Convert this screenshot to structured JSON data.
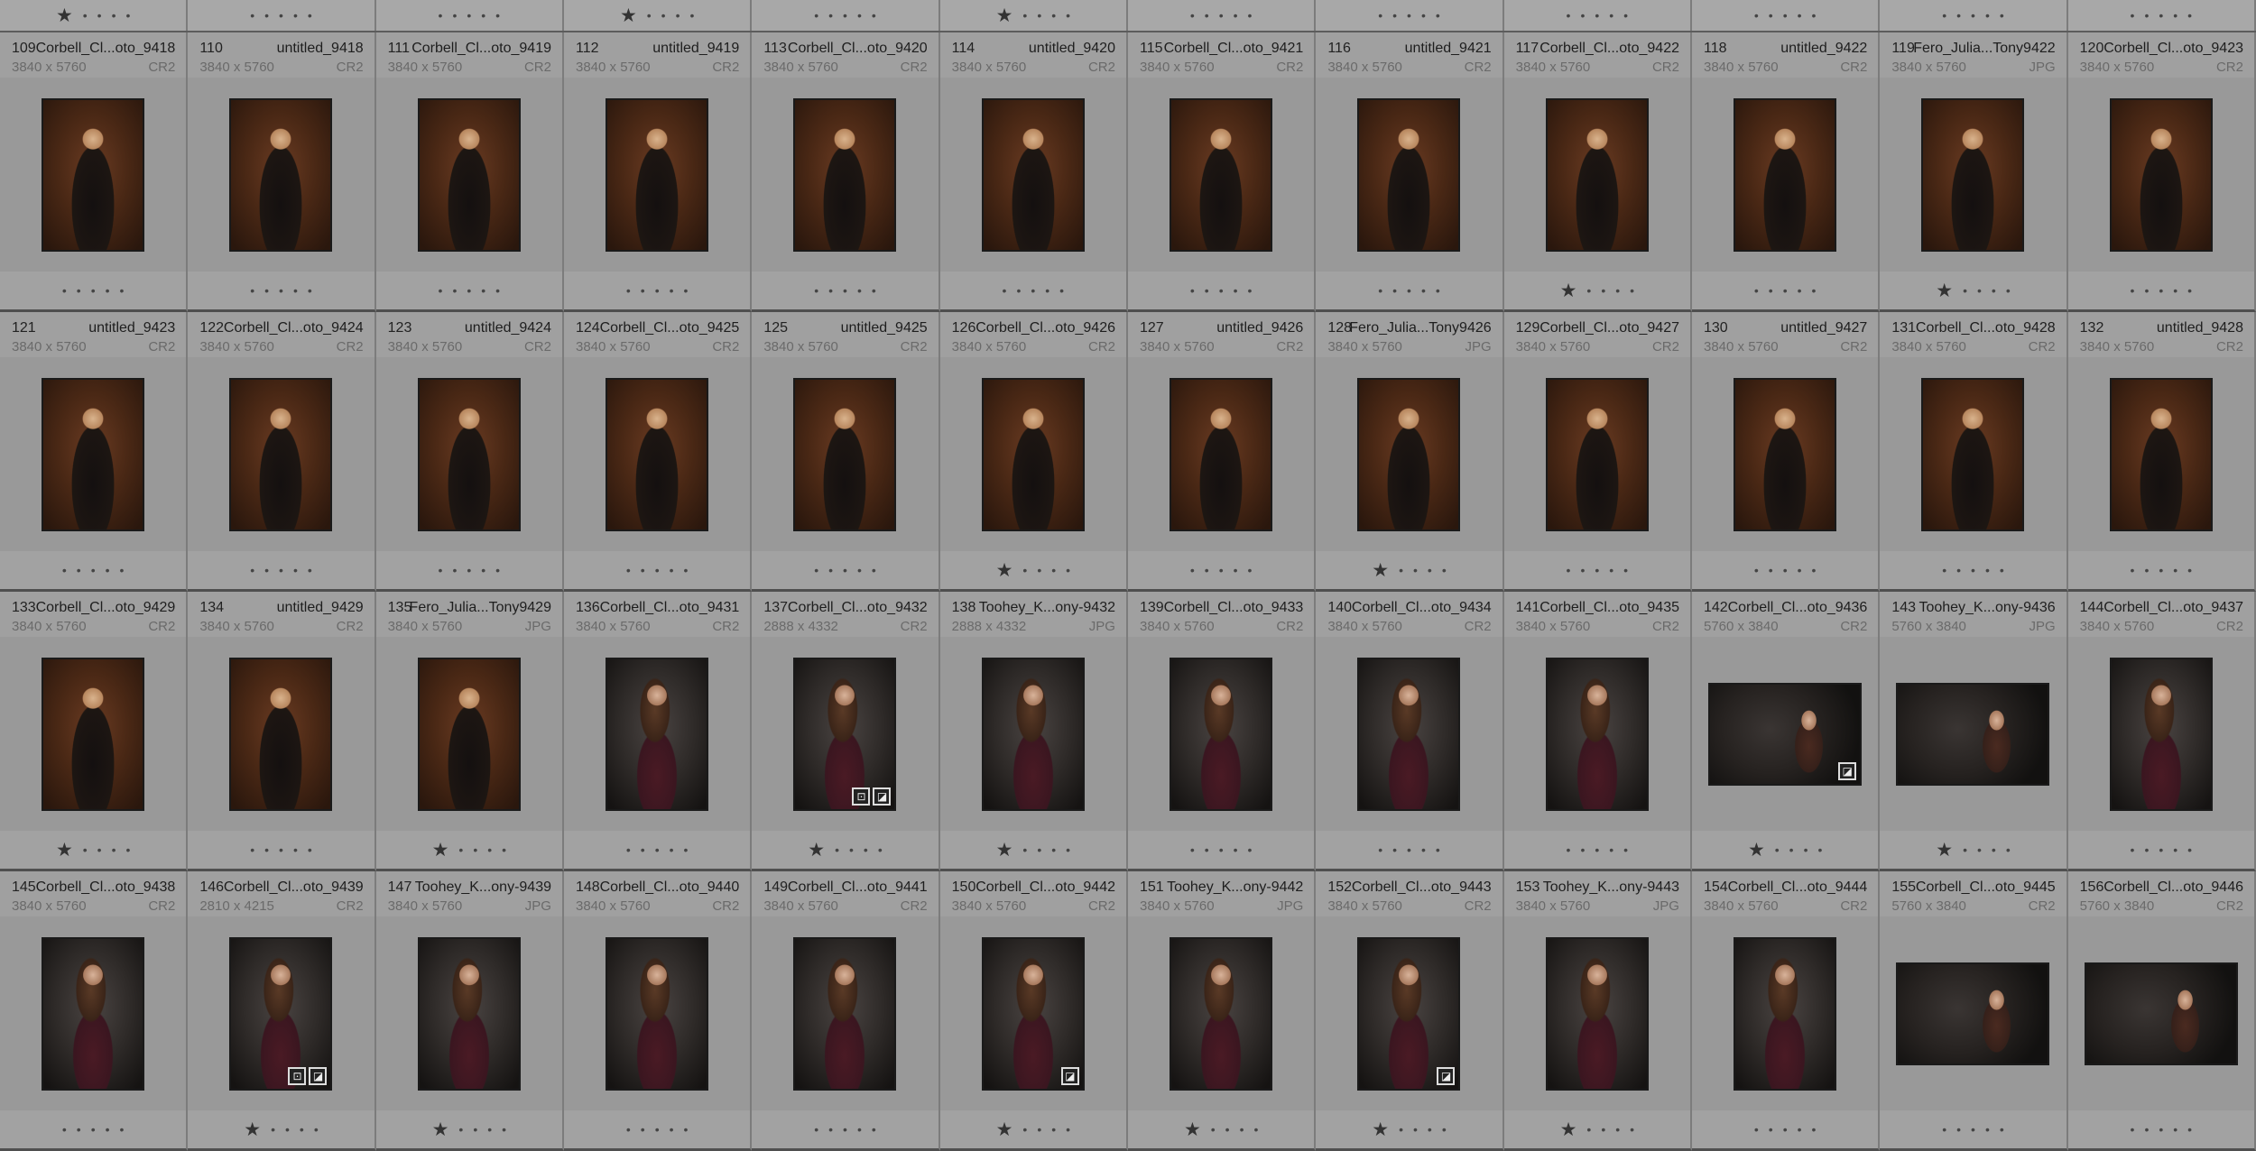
{
  "top_strip_ratings": [
    1,
    0,
    0,
    1,
    0,
    1,
    0,
    0,
    0,
    0,
    0,
    0
  ],
  "rows": [
    [
      {
        "idx": "109",
        "name": "Corbell_Cl...oto_9418",
        "dims": "3840 x 5760",
        "ext": "CR2",
        "rating": 0,
        "style": "warm",
        "orient": "portrait"
      },
      {
        "idx": "110",
        "name": "untitled_9418",
        "dims": "3840 x 5760",
        "ext": "CR2",
        "rating": 0,
        "style": "warm",
        "orient": "portrait"
      },
      {
        "idx": "111",
        "name": "Corbell_Cl...oto_9419",
        "dims": "3840 x 5760",
        "ext": "CR2",
        "rating": 0,
        "style": "warm",
        "orient": "portrait"
      },
      {
        "idx": "112",
        "name": "untitled_9419",
        "dims": "3840 x 5760",
        "ext": "CR2",
        "rating": 0,
        "style": "warm",
        "orient": "portrait"
      },
      {
        "idx": "113",
        "name": "Corbell_Cl...oto_9420",
        "dims": "3840 x 5760",
        "ext": "CR2",
        "rating": 0,
        "style": "warm",
        "orient": "portrait"
      },
      {
        "idx": "114",
        "name": "untitled_9420",
        "dims": "3840 x 5760",
        "ext": "CR2",
        "rating": 0,
        "style": "warm",
        "orient": "portrait"
      },
      {
        "idx": "115",
        "name": "Corbell_Cl...oto_9421",
        "dims": "3840 x 5760",
        "ext": "CR2",
        "rating": 0,
        "style": "warm",
        "orient": "portrait"
      },
      {
        "idx": "116",
        "name": "untitled_9421",
        "dims": "3840 x 5760",
        "ext": "CR2",
        "rating": 0,
        "style": "warm",
        "orient": "portrait"
      },
      {
        "idx": "117",
        "name": "Corbell_Cl...oto_9422",
        "dims": "3840 x 5760",
        "ext": "CR2",
        "rating": 1,
        "style": "warm",
        "orient": "portrait"
      },
      {
        "idx": "118",
        "name": "untitled_9422",
        "dims": "3840 x 5760",
        "ext": "CR2",
        "rating": 0,
        "style": "warm",
        "orient": "portrait"
      },
      {
        "idx": "119",
        "name": "Fero_Julia...Tony9422",
        "dims": "3840 x 5760",
        "ext": "JPG",
        "rating": 1,
        "style": "warm",
        "orient": "portrait"
      },
      {
        "idx": "120",
        "name": "Corbell_Cl...oto_9423",
        "dims": "3840 x 5760",
        "ext": "CR2",
        "rating": 0,
        "style": "warm",
        "orient": "portrait"
      }
    ],
    [
      {
        "idx": "121",
        "name": "untitled_9423",
        "dims": "3840 x 5760",
        "ext": "CR2",
        "rating": 0,
        "style": "warm",
        "orient": "portrait"
      },
      {
        "idx": "122",
        "name": "Corbell_Cl...oto_9424",
        "dims": "3840 x 5760",
        "ext": "CR2",
        "rating": 0,
        "style": "warm",
        "orient": "portrait"
      },
      {
        "idx": "123",
        "name": "untitled_9424",
        "dims": "3840 x 5760",
        "ext": "CR2",
        "rating": 0,
        "style": "warm",
        "orient": "portrait"
      },
      {
        "idx": "124",
        "name": "Corbell_Cl...oto_9425",
        "dims": "3840 x 5760",
        "ext": "CR2",
        "rating": 0,
        "style": "warm",
        "orient": "portrait"
      },
      {
        "idx": "125",
        "name": "untitled_9425",
        "dims": "3840 x 5760",
        "ext": "CR2",
        "rating": 0,
        "style": "warm",
        "orient": "portrait"
      },
      {
        "idx": "126",
        "name": "Corbell_Cl...oto_9426",
        "dims": "3840 x 5760",
        "ext": "CR2",
        "rating": 1,
        "style": "warm",
        "orient": "portrait"
      },
      {
        "idx": "127",
        "name": "untitled_9426",
        "dims": "3840 x 5760",
        "ext": "CR2",
        "rating": 0,
        "style": "warm",
        "orient": "portrait"
      },
      {
        "idx": "128",
        "name": "Fero_Julia...Tony9426",
        "dims": "3840 x 5760",
        "ext": "JPG",
        "rating": 1,
        "style": "warm",
        "orient": "portrait"
      },
      {
        "idx": "129",
        "name": "Corbell_Cl...oto_9427",
        "dims": "3840 x 5760",
        "ext": "CR2",
        "rating": 0,
        "style": "warm",
        "orient": "portrait"
      },
      {
        "idx": "130",
        "name": "untitled_9427",
        "dims": "3840 x 5760",
        "ext": "CR2",
        "rating": 0,
        "style": "warm",
        "orient": "portrait"
      },
      {
        "idx": "131",
        "name": "Corbell_Cl...oto_9428",
        "dims": "3840 x 5760",
        "ext": "CR2",
        "rating": 0,
        "style": "warm",
        "orient": "portrait"
      },
      {
        "idx": "132",
        "name": "untitled_9428",
        "dims": "3840 x 5760",
        "ext": "CR2",
        "rating": 0,
        "style": "warm",
        "orient": "portrait"
      }
    ],
    [
      {
        "idx": "133",
        "name": "Corbell_Cl...oto_9429",
        "dims": "3840 x 5760",
        "ext": "CR2",
        "rating": 1,
        "style": "warm",
        "orient": "portrait"
      },
      {
        "idx": "134",
        "name": "untitled_9429",
        "dims": "3840 x 5760",
        "ext": "CR2",
        "rating": 0,
        "style": "warm",
        "orient": "portrait"
      },
      {
        "idx": "135",
        "name": "Fero_Julia...Tony9429",
        "dims": "3840 x 5760",
        "ext": "JPG",
        "rating": 1,
        "style": "warm",
        "orient": "portrait"
      },
      {
        "idx": "136",
        "name": "Corbell_Cl...oto_9431",
        "dims": "3840 x 5760",
        "ext": "CR2",
        "rating": 0,
        "style": "dark",
        "orient": "portrait"
      },
      {
        "idx": "137",
        "name": "Corbell_Cl...oto_9432",
        "dims": "2888 x 4332",
        "ext": "CR2",
        "rating": 1,
        "style": "dark",
        "orient": "portrait",
        "badges": [
          "crop",
          "edit"
        ]
      },
      {
        "idx": "138",
        "name": "Toohey_K...ony-9432",
        "dims": "2888 x 4332",
        "ext": "JPG",
        "rating": 1,
        "style": "dark",
        "orient": "portrait"
      },
      {
        "idx": "139",
        "name": "Corbell_Cl...oto_9433",
        "dims": "3840 x 5760",
        "ext": "CR2",
        "rating": 0,
        "style": "dark",
        "orient": "portrait"
      },
      {
        "idx": "140",
        "name": "Corbell_Cl...oto_9434",
        "dims": "3840 x 5760",
        "ext": "CR2",
        "rating": 0,
        "style": "dark",
        "orient": "portrait"
      },
      {
        "idx": "141",
        "name": "Corbell_Cl...oto_9435",
        "dims": "3840 x 5760",
        "ext": "CR2",
        "rating": 0,
        "style": "dark",
        "orient": "portrait"
      },
      {
        "idx": "142",
        "name": "Corbell_Cl...oto_9436",
        "dims": "5760 x 3840",
        "ext": "CR2",
        "rating": 1,
        "style": "land",
        "orient": "landscape",
        "badges": [
          "edit"
        ]
      },
      {
        "idx": "143",
        "name": "Toohey_K...ony-9436",
        "dims": "5760 x 3840",
        "ext": "JPG",
        "rating": 1,
        "style": "land",
        "orient": "landscape"
      },
      {
        "idx": "144",
        "name": "Corbell_Cl...oto_9437",
        "dims": "3840 x 5760",
        "ext": "CR2",
        "rating": 0,
        "style": "dark",
        "orient": "portrait"
      }
    ],
    [
      {
        "idx": "145",
        "name": "Corbell_Cl...oto_9438",
        "dims": "3840 x 5760",
        "ext": "CR2",
        "rating": 0,
        "style": "dark",
        "orient": "portrait"
      },
      {
        "idx": "146",
        "name": "Corbell_Cl...oto_9439",
        "dims": "2810 x 4215",
        "ext": "CR2",
        "rating": 1,
        "style": "dark",
        "orient": "portrait",
        "badges": [
          "crop",
          "edit"
        ]
      },
      {
        "idx": "147",
        "name": "Toohey_K...ony-9439",
        "dims": "3840 x 5760",
        "ext": "JPG",
        "rating": 1,
        "style": "dark",
        "orient": "portrait"
      },
      {
        "idx": "148",
        "name": "Corbell_Cl...oto_9440",
        "dims": "3840 x 5760",
        "ext": "CR2",
        "rating": 0,
        "style": "dark",
        "orient": "portrait"
      },
      {
        "idx": "149",
        "name": "Corbell_Cl...oto_9441",
        "dims": "3840 x 5760",
        "ext": "CR2",
        "rating": 0,
        "style": "dark",
        "orient": "portrait"
      },
      {
        "idx": "150",
        "name": "Corbell_Cl...oto_9442",
        "dims": "3840 x 5760",
        "ext": "CR2",
        "rating": 1,
        "style": "dark",
        "orient": "portrait",
        "badges": [
          "edit"
        ]
      },
      {
        "idx": "151",
        "name": "Toohey_K...ony-9442",
        "dims": "3840 x 5760",
        "ext": "JPG",
        "rating": 1,
        "style": "dark",
        "orient": "portrait"
      },
      {
        "idx": "152",
        "name": "Corbell_Cl...oto_9443",
        "dims": "3840 x 5760",
        "ext": "CR2",
        "rating": 1,
        "style": "dark",
        "orient": "portrait",
        "badges": [
          "edit"
        ]
      },
      {
        "idx": "153",
        "name": "Toohey_K...ony-9443",
        "dims": "3840 x 5760",
        "ext": "JPG",
        "rating": 1,
        "style": "dark",
        "orient": "portrait"
      },
      {
        "idx": "154",
        "name": "Corbell_Cl...oto_9444",
        "dims": "3840 x 5760",
        "ext": "CR2",
        "rating": 0,
        "style": "dark",
        "orient": "portrait"
      },
      {
        "idx": "155",
        "name": "Corbell_Cl...oto_9445",
        "dims": "5760 x 3840",
        "ext": "CR2",
        "rating": 0,
        "style": "land",
        "orient": "landscape"
      },
      {
        "idx": "156",
        "name": "Corbell_Cl...oto_9446",
        "dims": "5760 x 3840",
        "ext": "CR2",
        "rating": 0,
        "style": "land",
        "orient": "landscape"
      }
    ]
  ],
  "icons": {
    "star": "star-icon",
    "dot": "rating-dot-icon",
    "crop": "crop-badge-icon",
    "edit": "develop-adjustment-badge-icon"
  },
  "glyphs": {
    "star": "★",
    "dot": "•",
    "crop": "⊡",
    "edit": "◪"
  },
  "colors": {
    "cell_bg": "#999999",
    "cell_info_bg": "#a0a0a0",
    "divider": "#4f4f4f",
    "text": "#1e1e1e",
    "muted": "#6a6a6a"
  }
}
